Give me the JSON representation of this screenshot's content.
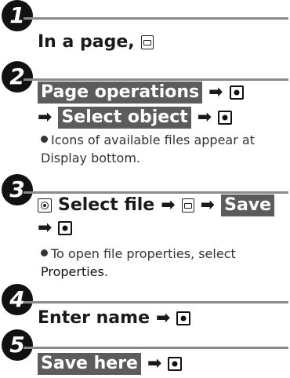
{
  "steps": [
    {
      "number": "1",
      "line1": "In a page,"
    },
    {
      "number": "2",
      "item1": "Page operations",
      "item2": "Select object",
      "note": "Icons of available files appear at Display bottom."
    },
    {
      "number": "3",
      "item1": "Select file",
      "item2": "Save",
      "note_pre": "To open file properties, select",
      "note_strong": "Properties",
      "note_post": "."
    },
    {
      "number": "4",
      "line1": "Enter name"
    },
    {
      "number": "5",
      "item1": "Save here"
    }
  ],
  "symbols": {
    "arrow": "➡"
  },
  "icons": [
    "mail-icon",
    "center-button-icon",
    "navigation-key-icon",
    "arrow-icon"
  ],
  "colors": {
    "highlight": "#5c5c5c",
    "rule": "#8a8a8a",
    "badge": "#111111"
  }
}
